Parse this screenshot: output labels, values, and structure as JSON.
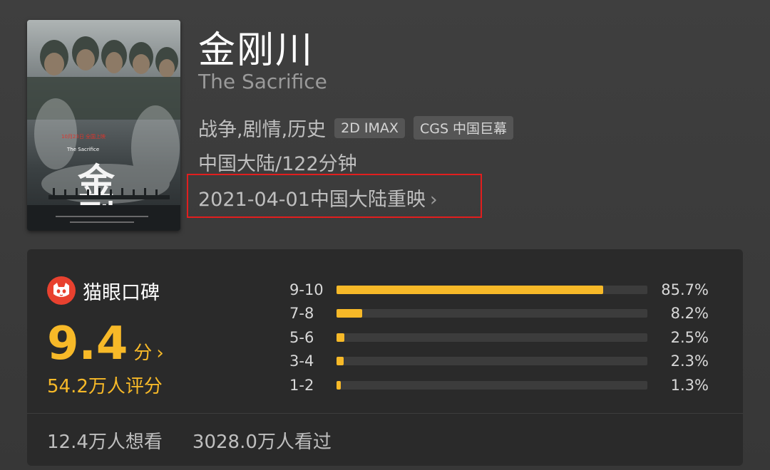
{
  "movie": {
    "title_cn": "金刚川",
    "title_en": "The Sacrifice",
    "genres": "战争,剧情,历史",
    "tags": [
      "2D IMAX",
      "CGS 中国巨幕"
    ],
    "region_duration": "中国大陆/122分钟",
    "release": "2021-04-01中国大陆重映",
    "release_chevron": "›"
  },
  "poster": {
    "title_glyphs": "金刚川",
    "subtitle": "The Sacrifice",
    "badge": "10月23日 全国上映"
  },
  "rating": {
    "brand": "猫眼口碑",
    "score": "9.4",
    "score_unit": "分",
    "score_chevron": "›",
    "count": "54.2万人评分",
    "distribution": [
      {
        "label": "9-10",
        "percent": 85.7,
        "text": "85.7%"
      },
      {
        "label": "7-8",
        "percent": 8.2,
        "text": "8.2%"
      },
      {
        "label": "5-6",
        "percent": 2.5,
        "text": "2.5%"
      },
      {
        "label": "3-4",
        "percent": 2.3,
        "text": "2.3%"
      },
      {
        "label": "1-2",
        "percent": 1.3,
        "text": "1.3%"
      }
    ]
  },
  "stats": {
    "want": "12.4万人想看",
    "watched": "3028.0万人看过"
  },
  "colors": {
    "accent": "#f7b928",
    "highlight_border": "#e21e1e",
    "brand_red": "#e8412f"
  }
}
